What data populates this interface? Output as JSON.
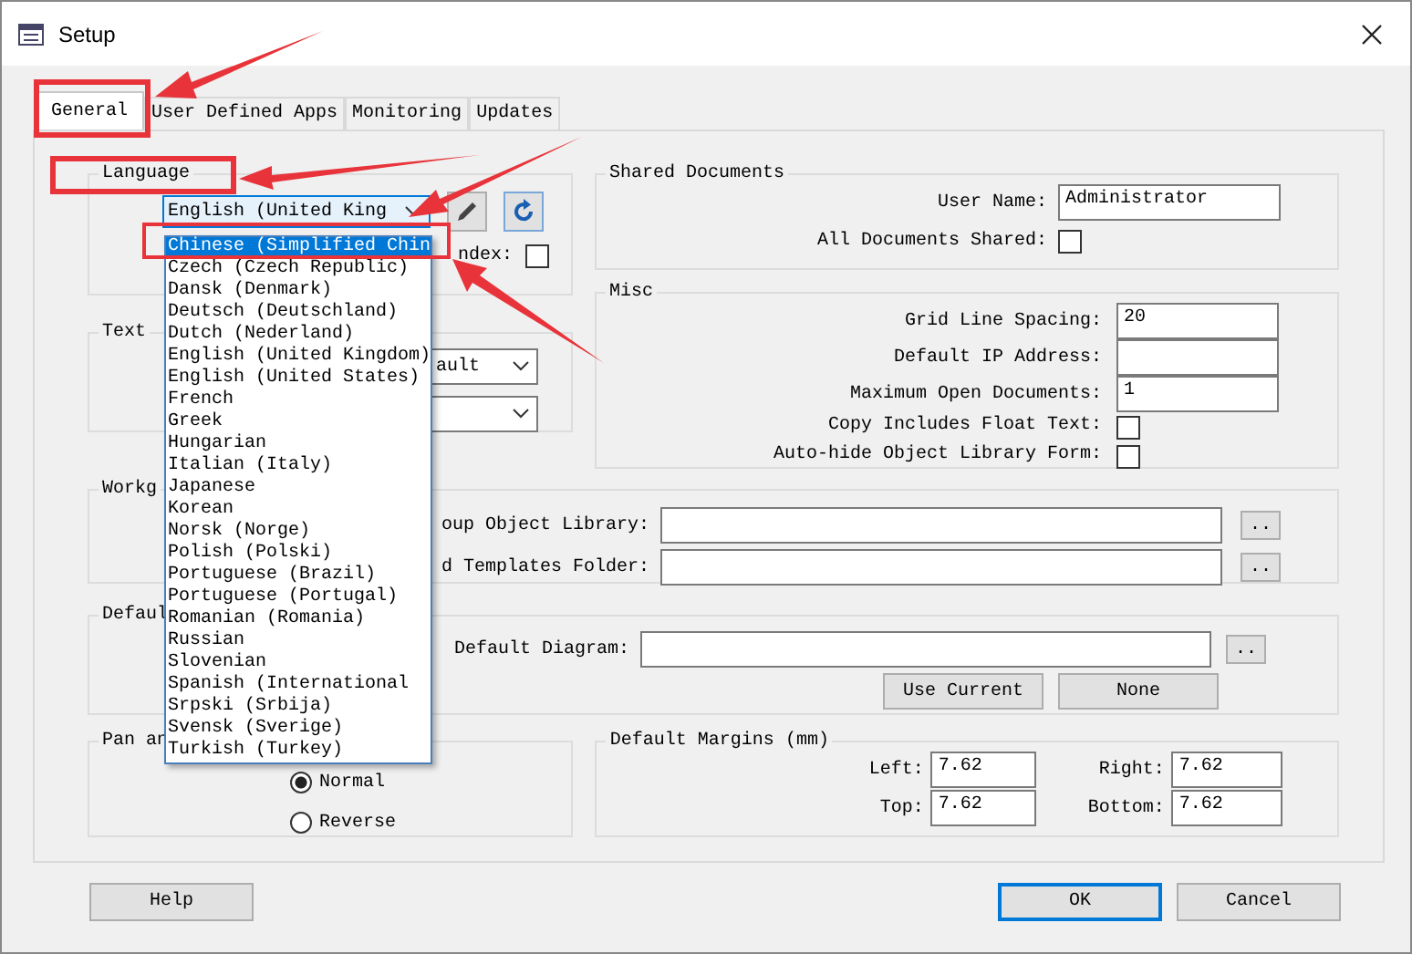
{
  "window": {
    "title": "Setup"
  },
  "tabs": [
    {
      "label": "General",
      "selected": true
    },
    {
      "label": "User Defined Apps",
      "selected": false
    },
    {
      "label": "Monitoring",
      "selected": false
    },
    {
      "label": "Updates",
      "selected": false
    }
  ],
  "language": {
    "title": "Language",
    "combo_value": "English (United King",
    "index_label": "ndex:",
    "index_checked": false
  },
  "language_list": [
    {
      "label": "Chinese (Simplified Chin",
      "selected": true
    },
    {
      "label": "Czech (Czech Republic)",
      "selected": false
    },
    {
      "label": "Dansk (Denmark)",
      "selected": false
    },
    {
      "label": "Deutsch (Deutschland)",
      "selected": false
    },
    {
      "label": "Dutch (Nederland)",
      "selected": false
    },
    {
      "label": "English (United Kingdom)",
      "selected": false
    },
    {
      "label": "English (United States)",
      "selected": false
    },
    {
      "label": "French",
      "selected": false
    },
    {
      "label": "Greek",
      "selected": false
    },
    {
      "label": "Hungarian",
      "selected": false
    },
    {
      "label": "Italian (Italy)",
      "selected": false
    },
    {
      "label": "Japanese",
      "selected": false
    },
    {
      "label": "Korean",
      "selected": false
    },
    {
      "label": "Norsk (Norge)",
      "selected": false
    },
    {
      "label": "Polish (Polski)",
      "selected": false
    },
    {
      "label": "Portuguese (Brazil)",
      "selected": false
    },
    {
      "label": "Portuguese (Portugal)",
      "selected": false
    },
    {
      "label": "Romanian (Romania)",
      "selected": false
    },
    {
      "label": "Russian",
      "selected": false
    },
    {
      "label": "Slovenian",
      "selected": false
    },
    {
      "label": "Spanish (International",
      "selected": false
    },
    {
      "label": "Srpski (Srbija)",
      "selected": false
    },
    {
      "label": "Svensk (Sverige)",
      "selected": false
    },
    {
      "label": "Turkish (Turkey)",
      "selected": false
    }
  ],
  "text_group": {
    "title": "Text",
    "combo_value": "ault"
  },
  "shared_documents": {
    "title": "Shared Documents",
    "user_name_label": "User Name:",
    "user_name": "Administrator",
    "all_shared_label": "All Documents Shared:",
    "all_shared_checked": false
  },
  "misc": {
    "title": "Misc",
    "rows": [
      {
        "kind": "field",
        "label": "Grid Line Spacing:",
        "value": "20"
      },
      {
        "kind": "field",
        "label": "Default IP Address:"
      },
      {
        "kind": "field",
        "label": "Maximum Open Documents:",
        "value": "1"
      },
      {
        "kind": "checkbox",
        "label": "Copy Includes Float Text:",
        "checked": false
      },
      {
        "kind": "checkbox",
        "label": "Auto-hide Object Library Form:",
        "checked": false
      }
    ]
  },
  "workgroup": {
    "title": "Workg",
    "rows": [
      {
        "label": "oup Object Library:",
        "browse": ".."
      },
      {
        "label": "d Templates Folder:",
        "browse": ".."
      }
    ]
  },
  "default_group": {
    "title": "Defaul",
    "label": "Default Diagram:",
    "browse": "..",
    "buttons": [
      "Use Current",
      "None"
    ]
  },
  "pan": {
    "title": "Pan an",
    "options": [
      {
        "label": "Normal",
        "selected": true
      },
      {
        "label": "Reverse",
        "selected": false
      }
    ]
  },
  "margins": {
    "title": "Default Margins (mm)",
    "fields": [
      {
        "label": "Left:",
        "value": "7.62"
      },
      {
        "label": "Right:",
        "value": "7.62"
      },
      {
        "label": "Top:",
        "value": "7.62"
      },
      {
        "label": "Bottom:",
        "value": "7.62"
      }
    ]
  },
  "buttons": [
    {
      "label": "Help",
      "default": false
    },
    {
      "label": "OK",
      "default": true
    },
    {
      "label": "Cancel",
      "default": false
    }
  ]
}
